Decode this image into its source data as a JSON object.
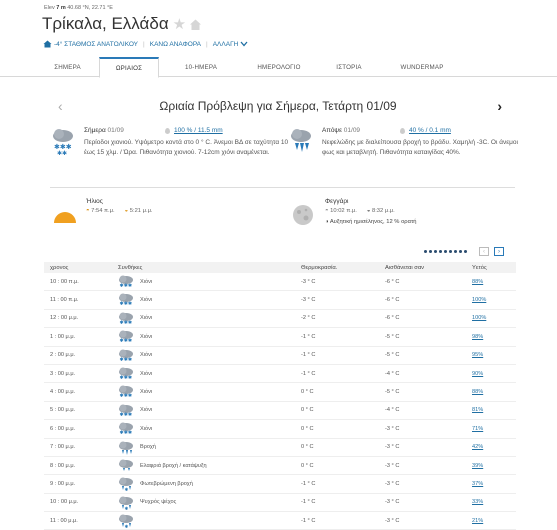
{
  "header": {
    "elevation_text": "Elev",
    "elevation_value": "7 m",
    "lat": "40.68",
    "lat_suffix": "°N,",
    "lon": "22.71",
    "lon_suffix": "°E",
    "city": "Τρίκαλα, Ελλάδα",
    "station": "-4° ΣΤΑΘΜΟΣ ΑΝΑΤΟΛΙΚΟΥ",
    "report": "ΚΑΝΩ ΑΝΑΦΟΡΑ",
    "change": "ΑΛΛΑΓΗ"
  },
  "tabs": [
    "ΣΗΜΕΡΑ",
    "ΩΡΙΑΙΟΣ",
    "10-ΗΜΕΡΑ",
    "ΗΜΕΡΟΛΟΓΙΟ",
    "ΙΣΤΟΡΙΑ",
    "WUNDERMAP"
  ],
  "active_tab": 1,
  "forecast": {
    "title": "Ωριαία Πρόβλεψη για Σήμερα, Τετάρτη 01/09",
    "today": {
      "label": "Σήμερα",
      "date": "01/09",
      "precip": "100 % / 11.5 mm",
      "desc": "Περίοδοι χιονιού. Υψόμετρο κοντά στο 0 ° C. Άνεμοι ΒΔ σε ταχύτητα 10 έως 15 χλμ. / Ώρα. Πιθανότητα χιονιού. 7-12cm χιόνι αναμένεται."
    },
    "tonight": {
      "label": "Απόψε",
      "date": "01/09",
      "precip": "40 % / 0.1 mm",
      "desc": "Νεφελώδης με διαλείπουσα βροχή το βράδυ. Χαμηλή -3C. Οι άνεμοι φως και μεταβλητή. Πιθανότητα καταιγίδας 40%."
    }
  },
  "sun": {
    "label": "Ήλιος",
    "rise": "7:54 π.μ.",
    "set": "5:21 μ.μ."
  },
  "moon": {
    "label": "Φεγγάρι",
    "rise": "10:02 π.μ.",
    "set": "8:32 μ.μ.",
    "phase": "Αυξητική ημισέληνος, 12 % ορατή"
  },
  "table": {
    "headers": {
      "time": "χρονος",
      "cond": "Συνθήκες",
      "temp": "Θερμοκρασία.",
      "feel": "Αισθάνεται σαν",
      "prec": "Υετός"
    },
    "rows": [
      {
        "time": "10 : 00 π.μ.",
        "icon": "snow-icon",
        "cond": "Χιόνι",
        "temp": "-3 ° C",
        "feel": "-6 ° C",
        "prec": "88%"
      },
      {
        "time": "11 : 00 π.μ.",
        "icon": "snow-icon",
        "cond": "Χιόνι",
        "temp": "-3 ° C",
        "feel": "-6 ° C",
        "prec": "100%"
      },
      {
        "time": "12 : 00 μ.μ.",
        "icon": "snow-icon",
        "cond": "Χιόνι",
        "temp": "-2 ° C",
        "feel": "-6 ° C",
        "prec": "100%"
      },
      {
        "time": "1 : 00 μ.μ.",
        "icon": "snow-icon",
        "cond": "Χιόνι",
        "temp": "-1 ° C",
        "feel": "-5 ° C",
        "prec": "98%"
      },
      {
        "time": "2 : 00 μ.μ.",
        "icon": "snow-icon",
        "cond": "Χιόνι",
        "temp": "-1 ° C",
        "feel": "-5 ° C",
        "prec": "95%"
      },
      {
        "time": "3 : 00 μ.μ.",
        "icon": "snow-icon",
        "cond": "Χιόνι",
        "temp": "-1 ° C",
        "feel": "-4 ° C",
        "prec": "90%"
      },
      {
        "time": "4 : 00 μ.μ.",
        "icon": "snow-icon",
        "cond": "Χιόνι",
        "temp": "0 ° C",
        "feel": "-5 ° C",
        "prec": "88%"
      },
      {
        "time": "5 : 00 μ.μ.",
        "icon": "snow-icon",
        "cond": "Χιόνι",
        "temp": "0 ° C",
        "feel": "-4 ° C",
        "prec": "81%"
      },
      {
        "time": "6 : 00 μ.μ.",
        "icon": "snow-icon",
        "cond": "Χιόνι",
        "temp": "0 ° C",
        "feel": "-3 ° C",
        "prec": "71%"
      },
      {
        "time": "7 : 00 μ.μ.",
        "icon": "rain-icon",
        "cond": "Βροχή",
        "temp": "0 ° C",
        "feel": "-3 ° C",
        "prec": "42%"
      },
      {
        "time": "8 : 00 μ.μ.",
        "icon": "light-rain-icon",
        "cond": "Ελαφριά βροχή / κατάψυξη",
        "temp": "0 ° C",
        "feel": "-3 ° C",
        "prec": "39%"
      },
      {
        "time": "9 : 00 μ.μ.",
        "icon": "sleet-icon",
        "cond": "Φωτεβρώμενη βροχή",
        "temp": "-1 ° C",
        "feel": "-3 ° C",
        "prec": "37%"
      },
      {
        "time": "10 : 00 μ.μ.",
        "icon": "sleet-icon",
        "cond": "Ψυχρός ψέχος",
        "temp": "-1 ° C",
        "feel": "-3 ° C",
        "prec": "33%"
      },
      {
        "time": "11 : 00 μ.μ.",
        "icon": "sleet-icon",
        "cond": "",
        "temp": "-1 ° C",
        "feel": "-3 ° C",
        "prec": "21%"
      }
    ]
  }
}
